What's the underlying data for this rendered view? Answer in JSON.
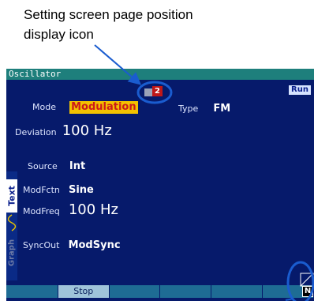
{
  "annotation": {
    "line1": "Setting screen page position",
    "line2": "display icon"
  },
  "window": {
    "title": "Oscillator"
  },
  "page_indicator": {
    "number": "2",
    "icon": "page-position-icon"
  },
  "status": {
    "run_label": "Run"
  },
  "params": {
    "mode": {
      "label": "Mode",
      "value": "Modulation"
    },
    "type": {
      "label": "Type",
      "value": "FM"
    },
    "deviation": {
      "label": "Deviation",
      "value": "100 Hz"
    },
    "source": {
      "label": "Source",
      "value": "Int"
    },
    "modfctn": {
      "label": "ModFctn",
      "value": "Sine"
    },
    "modfreq": {
      "label": "ModFreq",
      "value": "100 Hz"
    },
    "syncout": {
      "label": "SyncOut",
      "value": "ModSync"
    }
  },
  "side_tabs": {
    "text": "Text",
    "graph": "Graph"
  },
  "softkeys": [
    "",
    "Stop",
    "",
    "",
    "",
    ""
  ],
  "corner": {
    "badge": "N"
  },
  "colors": {
    "screen_bg": "#061a6b",
    "title_bar": "#1e7f7c",
    "highlight_bg": "#f2c200",
    "highlight_text": "#cc1a1a",
    "annotation": "#1a5ccf"
  }
}
